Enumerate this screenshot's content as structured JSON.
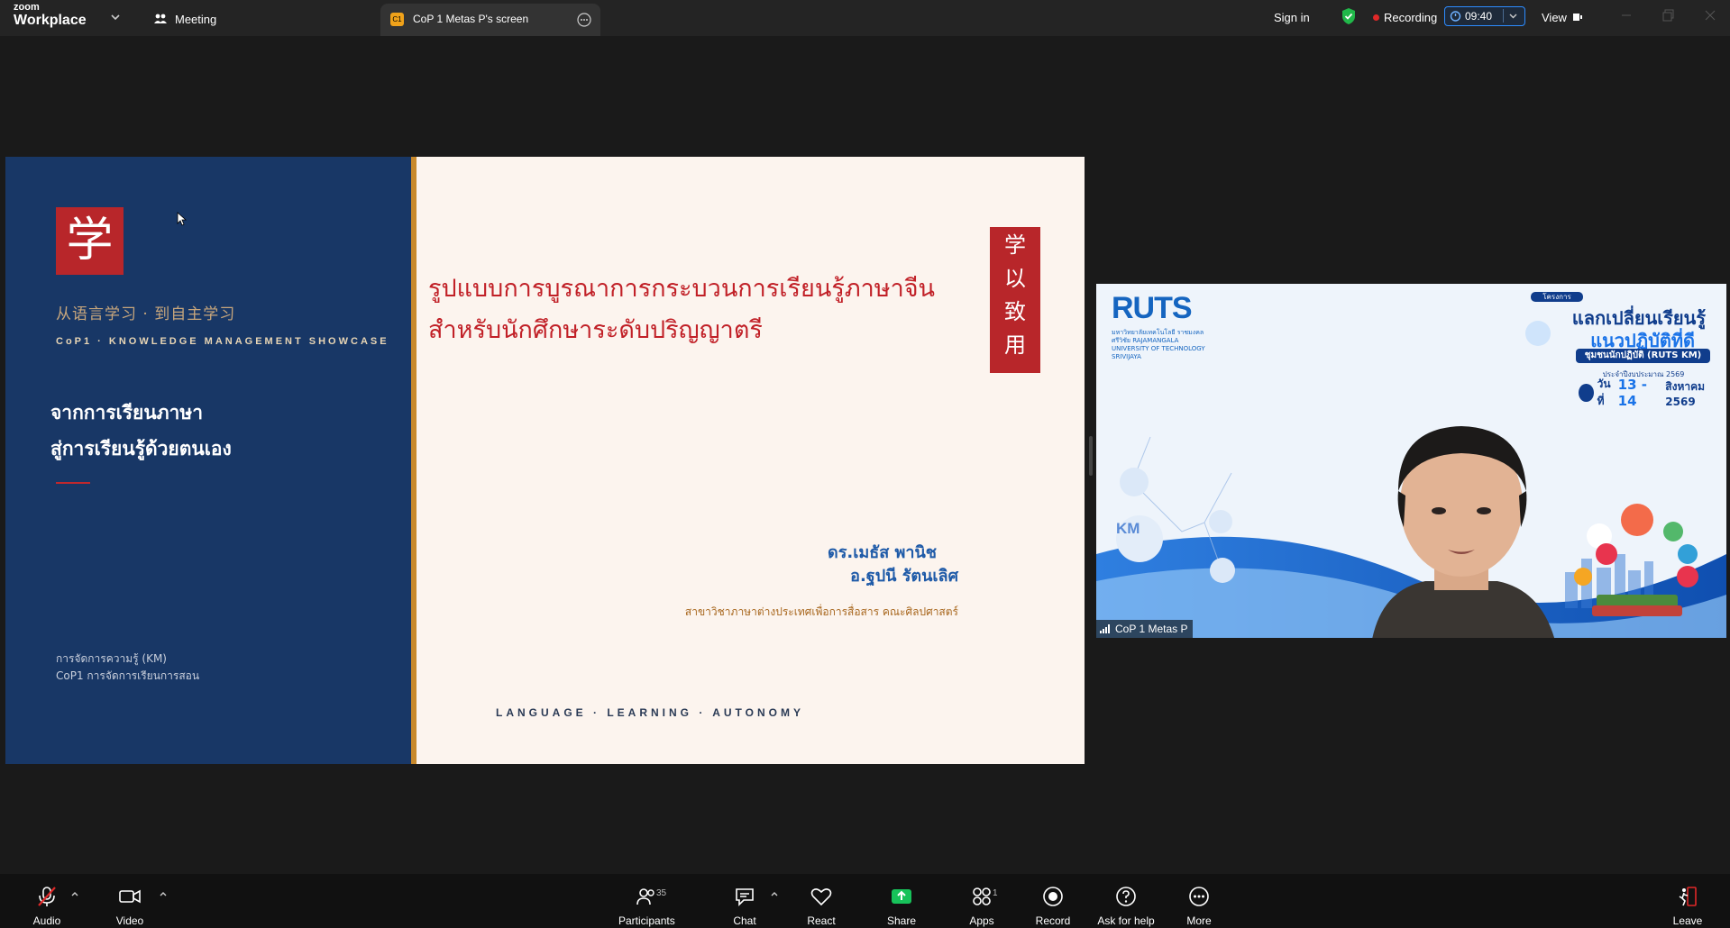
{
  "app": {
    "logo_line1": "zoom",
    "logo_line2": "Workplace"
  },
  "tabs": {
    "meeting": "Meeting",
    "screen_badge": "C1",
    "screen": "CoP 1 Metas P's screen"
  },
  "topbar": {
    "sign_in": "Sign in",
    "recording": "Recording",
    "timer": "09:40",
    "view": "View"
  },
  "slide": {
    "left": {
      "icon_char": "学",
      "chinese_subtitle": "从语言学习 · 到自主学习",
      "cop_line": "CoP1 · KNOWLEDGE MANAGEMENT SHOWCASE",
      "thai_line1": "จากการเรียนภาษา",
      "thai_line2": "สู่การเรียนรู้ด้วยตนเอง",
      "km_line1": "การจัดการความรู้ (KM)",
      "km_line2": "CoP1 การจัดการเรียนการสอน"
    },
    "right": {
      "title_line1": "รูปแบบการบูรณาการกระบวนการเรียนรู้ภาษาจีน",
      "title_line2": "สำหรับนักศึกษาระดับปริญญาตรี",
      "vertical_chars": [
        "学",
        "以",
        "致",
        "用"
      ],
      "author1": "ดร.เมธัส พานิช",
      "author2": "อ.ฐปนี รัตนเลิศ",
      "department": "สาขาวิชาภาษาต่างประเทศเพื่อการสื่อสาร  คณะศิลปศาสตร์",
      "footer": "LANGUAGE  ·  LEARNING  ·  AUTONOMY"
    }
  },
  "video": {
    "brand": "RUTS",
    "brand_sub": "มหาวิทยาลัยเทคโนโลยี ราชมงคลศรีวิชัย RAJAMANGALA UNIVERSITY OF TECHNOLOGY SRIVIJAYA",
    "event_tag": "โครงการ",
    "event_title1": "แลกเปลี่ยนเรียนรู้",
    "event_title2": "แนวปฏิบัติที่ดี",
    "event_band": "ชุมชนนักปฏิบัติ (RUTS KM)",
    "event_budget": "ประจำปีงบประมาณ 2569",
    "event_date_prefix": "วันที่",
    "event_date_days": "13 - 14",
    "event_date_suffix": "สิงหาคม 2569",
    "km_label": "KM",
    "participant_name": "CoP 1 Metas P"
  },
  "toolbar": {
    "audio": "Audio",
    "video": "Video",
    "participants": "Participants",
    "participants_count": "35",
    "chat": "Chat",
    "react": "React",
    "share": "Share",
    "apps": "Apps",
    "apps_count": "1",
    "record": "Record",
    "ask_for_help": "Ask for help",
    "more": "More",
    "leave": "Leave"
  },
  "colors": {
    "slide_navy": "#183766",
    "slide_red": "#b8262a",
    "accent_blue": "#2d8cff",
    "share_green": "#17c25a",
    "recording_red": "#e02828"
  }
}
